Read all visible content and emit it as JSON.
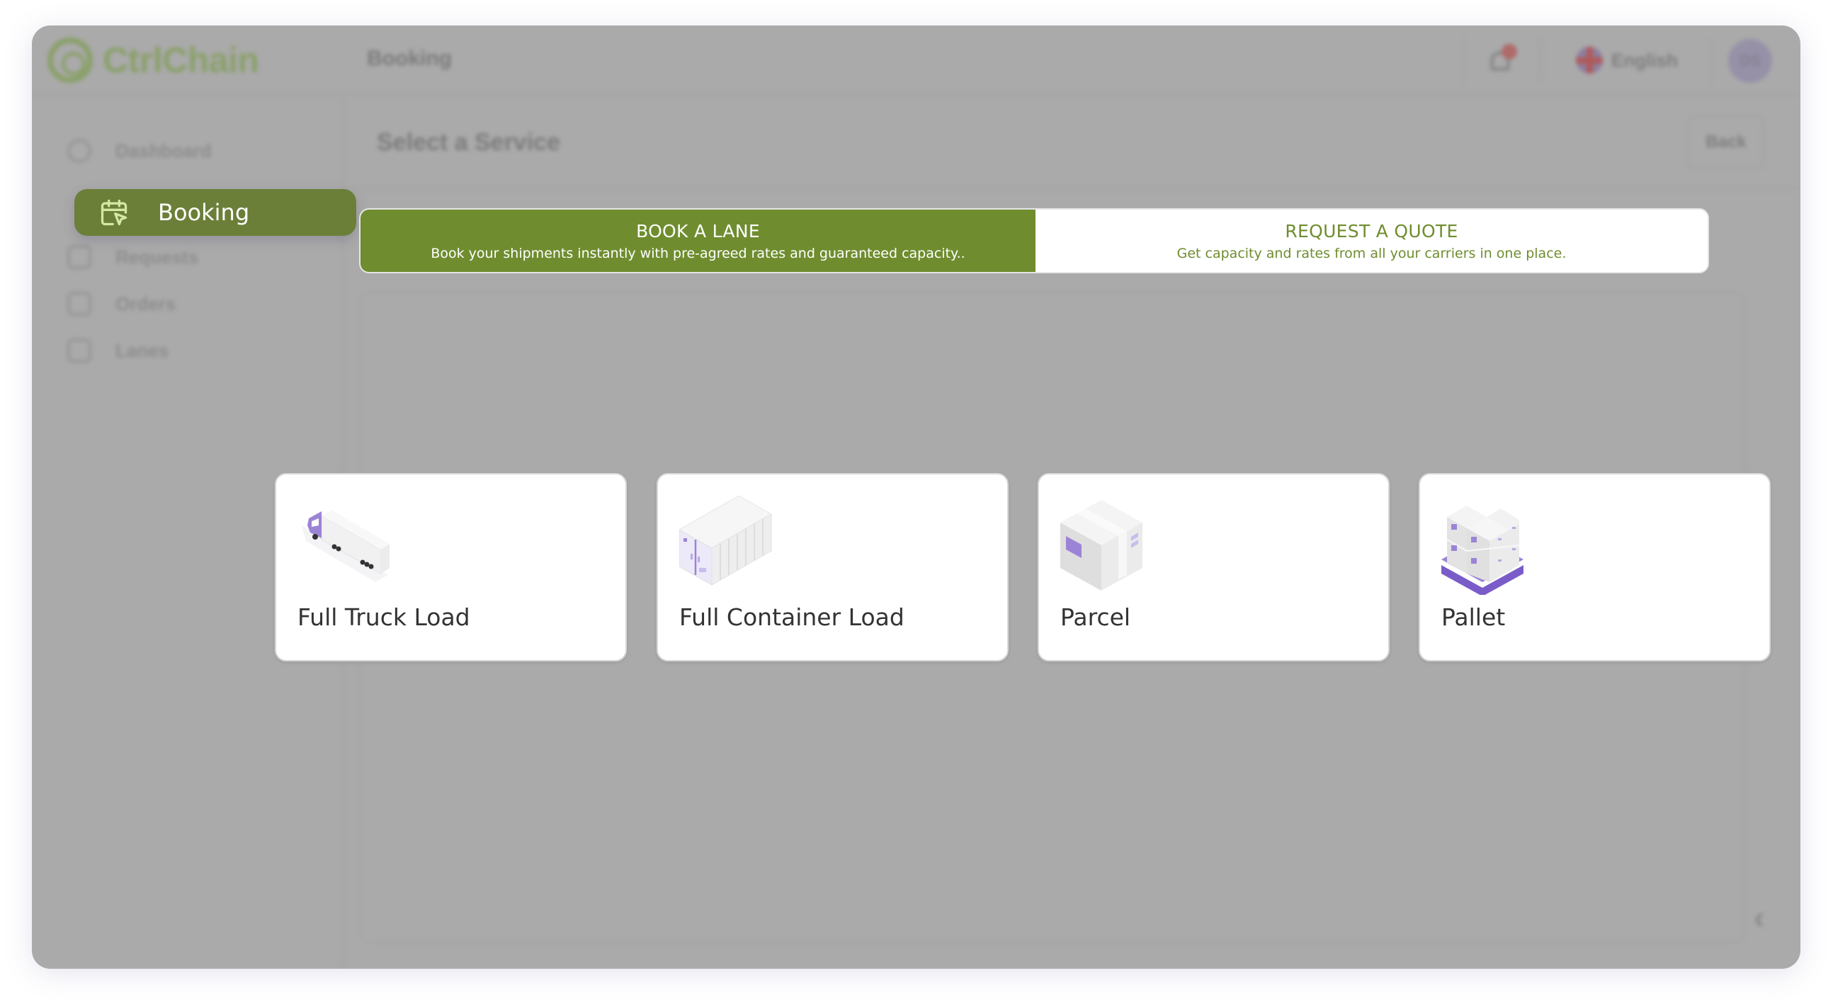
{
  "app": {
    "brand_name": "CtrlChain",
    "page_title": "Booking",
    "language_label": "English",
    "avatar_initials": "DS",
    "colors": {
      "accent_green": "#6f8d2f",
      "sidebar_active": "#6b7f38",
      "illustration_purple": "#9b84d6",
      "overlay_gray": "#aaaaaa"
    }
  },
  "sidebar": {
    "items": [
      {
        "label": "Dashboard",
        "icon": "dashboard-icon",
        "active": false
      },
      {
        "label": "Booking",
        "icon": "calendar-booking-icon",
        "active": true
      },
      {
        "label": "Requests",
        "icon": "requests-icon",
        "active": false
      },
      {
        "label": "Orders",
        "icon": "orders-icon",
        "active": false
      },
      {
        "label": "Lanes",
        "icon": "lanes-icon",
        "active": false
      }
    ]
  },
  "main": {
    "title": "Select a Service",
    "back_label": "Back",
    "tabs": [
      {
        "title": "BOOK A LANE",
        "subtitle": "Book your shipments instantly with pre-agreed rates and guaranteed capacity..",
        "active": true
      },
      {
        "title": "REQUEST A QUOTE",
        "subtitle": "Get capacity and rates from all your carriers in one place.",
        "active": false
      }
    ],
    "services": [
      {
        "label": "Full Truck Load",
        "icon": "truck-icon"
      },
      {
        "label": "Full Container Load",
        "icon": "container-icon"
      },
      {
        "label": "Parcel",
        "icon": "parcel-box-icon"
      },
      {
        "label": "Pallet",
        "icon": "pallet-icon"
      }
    ]
  }
}
